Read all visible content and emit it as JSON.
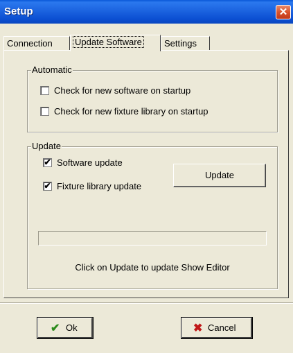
{
  "window": {
    "title": "Setup",
    "close_icon": "✕"
  },
  "tabs": [
    {
      "label": "Connection"
    },
    {
      "label": "Update Software",
      "active": true
    },
    {
      "label": "Settings"
    }
  ],
  "automatic": {
    "legend": "Automatic",
    "options": [
      {
        "label": "Check for new software on startup",
        "checked": false
      },
      {
        "label": "Check for new fixture library on startup",
        "checked": false
      }
    ]
  },
  "update": {
    "legend": "Update",
    "options": [
      {
        "label": "Software update",
        "checked": true
      },
      {
        "label": "Fixture library update",
        "checked": true
      }
    ],
    "button_label": "Update",
    "progress": 0,
    "status_text": "Click on Update to update Show Editor"
  },
  "buttons": {
    "ok": {
      "label": "Ok",
      "icon": "✔",
      "icon_color": "#2a8a1a"
    },
    "cancel": {
      "label": "Cancel",
      "icon": "✖",
      "icon_color": "#c01818"
    }
  },
  "check_mark": "✔"
}
